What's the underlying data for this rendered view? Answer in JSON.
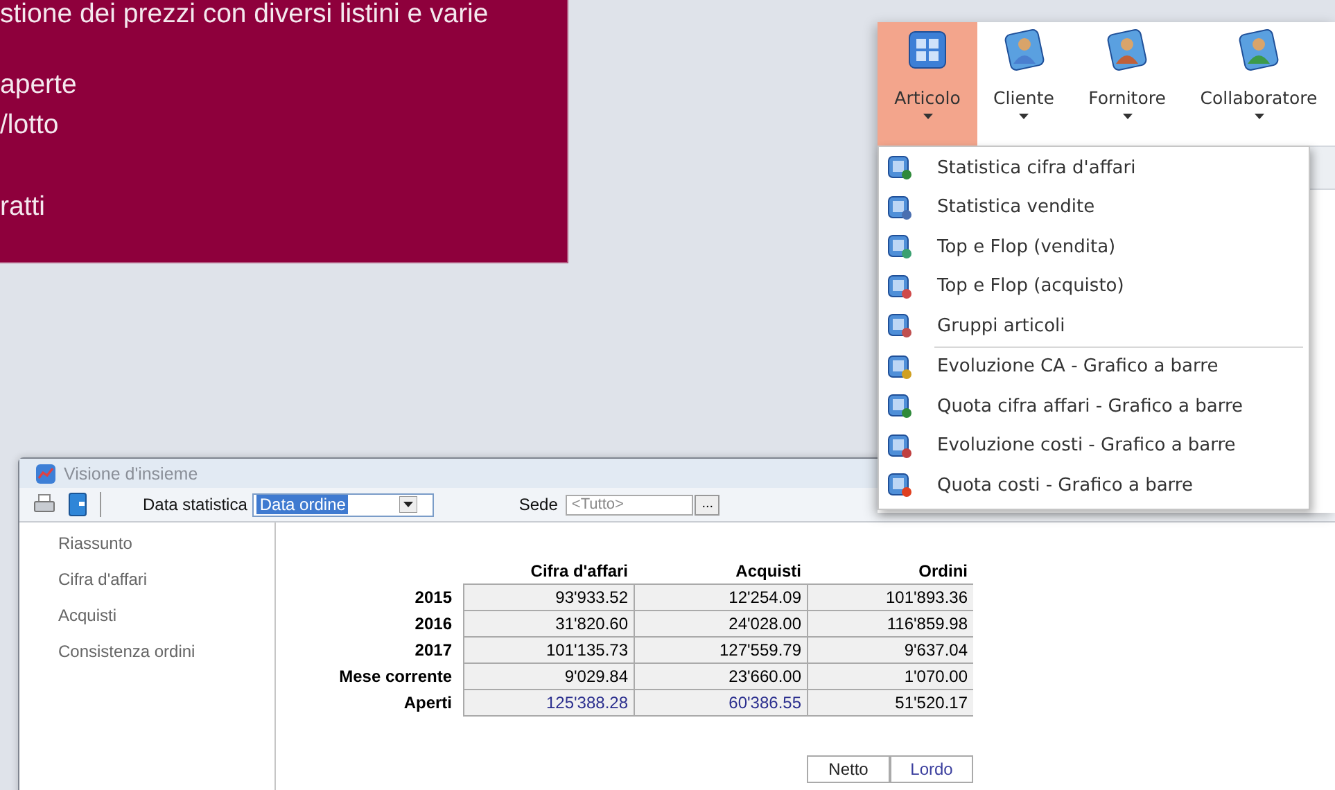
{
  "promo_panel": {
    "lines": [
      "stione dei prezzi con diversi listini e varie",
      "aperte",
      "/lotto",
      "ratti"
    ]
  },
  "ribbon": {
    "buttons": [
      {
        "label": "Articolo",
        "selected": true
      },
      {
        "label": "Cliente",
        "selected": false
      },
      {
        "label": "Fornitore",
        "selected": false
      },
      {
        "label": "Collaboratore",
        "selected": false
      }
    ]
  },
  "dropdown_menu": {
    "groups": [
      [
        "Statistica cifra d'affari",
        "Statistica vendite",
        "Top e Flop (vendita)",
        "Top e Flop (acquisto)",
        "Gruppi articoli"
      ],
      [
        "Evoluzione CA - Grafico a barre",
        "Quota cifra affari - Grafico a barre",
        "Evoluzione costi - Grafico a barre",
        "Quota costi - Grafico a barre"
      ]
    ]
  },
  "window": {
    "title": "Visione d'insieme",
    "toolbar": {
      "date_label": "Data statistica",
      "date_value": "Data ordine",
      "site_label": "Sede",
      "site_placeholder": "<Tutto>",
      "browse_button": "..."
    },
    "sidebar": {
      "items": [
        {
          "label": "Riassunto",
          "selected": false
        },
        {
          "label": "Cifra d'affari",
          "selected": false
        },
        {
          "label": "Acquisti",
          "selected": false
        },
        {
          "label": "Consistenza ordini",
          "selected": false
        }
      ]
    },
    "table": {
      "columns": [
        "Cifra d'affari",
        "Acquisti",
        "Ordini"
      ],
      "rows": [
        {
          "label": "2015",
          "cells": [
            {
              "value": "93'933.52",
              "link": false
            },
            {
              "value": "12'254.09",
              "link": false
            },
            {
              "value": "101'893.36",
              "link": false
            }
          ]
        },
        {
          "label": "2016",
          "cells": [
            {
              "value": "31'820.60",
              "link": false
            },
            {
              "value": "24'028.00",
              "link": false
            },
            {
              "value": "116'859.98",
              "link": false
            }
          ]
        },
        {
          "label": "2017",
          "cells": [
            {
              "value": "101'135.73",
              "link": false
            },
            {
              "value": "127'559.79",
              "link": false
            },
            {
              "value": "9'637.04",
              "link": false
            }
          ]
        },
        {
          "label": "Mese corrente",
          "cells": [
            {
              "value": "9'029.84",
              "link": false
            },
            {
              "value": "23'660.00",
              "link": false
            },
            {
              "value": "1'070.00",
              "link": false
            }
          ]
        },
        {
          "label": "Aperti",
          "cells": [
            {
              "value": "125'388.28",
              "link": true
            },
            {
              "value": "60'386.55",
              "link": true
            },
            {
              "value": "51'520.17",
              "link": false
            }
          ]
        }
      ]
    },
    "toggle": [
      {
        "label": "Netto",
        "selected": false
      },
      {
        "label": "Lordo",
        "selected": true
      }
    ]
  }
}
